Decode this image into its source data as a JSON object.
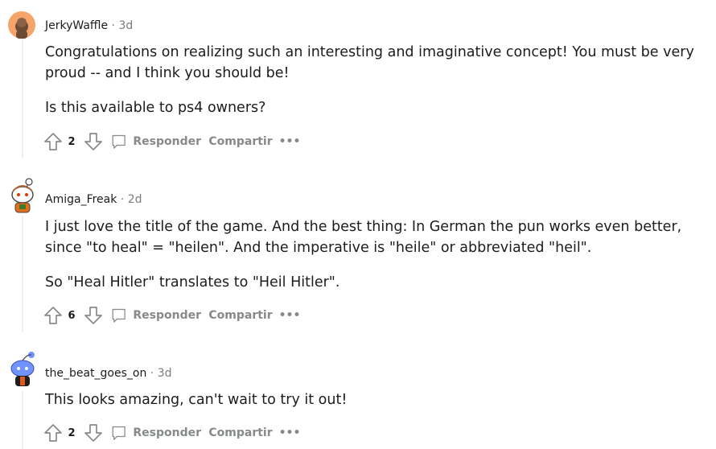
{
  "comments": [
    {
      "username": "JerkyWaffle",
      "separator": "·",
      "time": "3d",
      "paragraphs": [
        "Congratulations on realizing such an interesting and imaginative concept! You must be very proud -- and I think you should be!",
        "Is this available to ps4 owners?"
      ],
      "votes": "2",
      "reply_label": "Responder",
      "share_label": "Compartir",
      "more_label": "•••"
    },
    {
      "username": "Amiga_Freak",
      "separator": "·",
      "time": "2d",
      "paragraphs": [
        "I just love the title of the game. And the best thing: In German the pun works even better, since \"to heal\" = \"heilen\". And the imperative is \"heile\" or abbreviated \"heil\".",
        "So \"Heal Hitler\" translates to \"Heil Hitler\"."
      ],
      "votes": "6",
      "reply_label": "Responder",
      "share_label": "Compartir",
      "more_label": "•••"
    },
    {
      "username": "the_beat_goes_on",
      "separator": "·",
      "time": "3d",
      "paragraphs": [
        "This looks amazing, can't wait to try it out!"
      ],
      "votes": "2",
      "reply_label": "Responder",
      "share_label": "Compartir",
      "more_label": "•••"
    }
  ],
  "colors": {
    "meta_gray": "#7c7c7c",
    "action_gray": "#878a8c",
    "thread_line": "#edeff1",
    "avatar_orange": "#f5a46a",
    "avatar_purple": "#7193ff"
  }
}
